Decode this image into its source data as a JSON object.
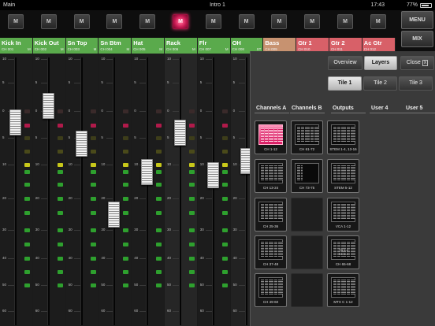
{
  "status": {
    "left": "Main",
    "center": "Intro 1",
    "time": "17:43",
    "battery": "77%"
  },
  "menu": {
    "menu_label": "MENU",
    "mix_label": "MIX"
  },
  "mute_label": "M",
  "mute_buttons": [
    {
      "on": false
    },
    {
      "on": false
    },
    {
      "on": false
    },
    {
      "on": false
    },
    {
      "on": false
    },
    {
      "on": true
    },
    {
      "on": false
    },
    {
      "on": false
    },
    {
      "on": false
    },
    {
      "on": false
    },
    {
      "on": false
    },
    {
      "on": false
    }
  ],
  "channels": [
    {
      "name": "Kick In",
      "sub": "CH 001",
      "tag": "M",
      "color": "#5aaa4c"
    },
    {
      "name": "Kick Out",
      "sub": "CH 002",
      "tag": "M",
      "color": "#5aaa4c"
    },
    {
      "name": "Sn Top",
      "sub": "CH 003",
      "tag": "M",
      "color": "#5aaa4c"
    },
    {
      "name": "Sn Btm",
      "sub": "CH 004",
      "tag": "M",
      "color": "#5aaa4c"
    },
    {
      "name": "Hat",
      "sub": "CH 005",
      "tag": "M",
      "color": "#5aaa4c"
    },
    {
      "name": "Rack",
      "sub": "CH 006",
      "tag": "M",
      "color": "#5aaa4c"
    },
    {
      "name": "Flr",
      "sub": "CH 007",
      "tag": "M",
      "color": "#5aaa4c"
    },
    {
      "name": "OH",
      "sub": "CH 008",
      "tag": "ST",
      "color": "#5aaa4c"
    },
    {
      "name": "Bass",
      "sub": "CH 009",
      "tag": "",
      "color": "#c79270"
    },
    {
      "name": "Gtr 1",
      "sub": "CH 010",
      "tag": "",
      "color": "#d86068"
    },
    {
      "name": "Gtr 2",
      "sub": "CH 011",
      "tag": "",
      "color": "#d86068"
    },
    {
      "name": "Ac Gtr",
      "sub": "CH 012",
      "tag": "",
      "color": "#d86068"
    }
  ],
  "scale": [
    "10",
    "5",
    "0",
    "5",
    "10",
    "20",
    "30",
    "40",
    "50",
    "60"
  ],
  "faders": [
    {
      "level_db": -2
    },
    {
      "level_db": 1
    },
    {
      "level_db": -6
    },
    {
      "level_db": -25
    },
    {
      "level_db": -12
    },
    {
      "level_db": -4
    },
    {
      "level_db": -13
    }
  ],
  "panel": {
    "overview_label": "Overview",
    "layers_label": "Layers",
    "close_label": "Close",
    "close_icon": "X",
    "tiles_tabs": [
      {
        "label": "Tile 1",
        "selected": true
      },
      {
        "label": "Tile 2",
        "selected": false
      },
      {
        "label": "Tile 3",
        "selected": false
      }
    ],
    "columns": [
      "Channels A",
      "Channels B",
      "Outputs",
      "User 4",
      "User 5"
    ],
    "tiles": [
      {
        "col": 0,
        "row": 0,
        "label": "CH 1-12",
        "style": "pink"
      },
      {
        "col": 1,
        "row": 0,
        "label": "CH 61-72",
        "style": "normal"
      },
      {
        "col": 2,
        "row": 0,
        "label": "STEM 1-4, 13-16",
        "style": "normal"
      },
      {
        "col": 0,
        "row": 1,
        "label": "CH 13-24",
        "style": "normal"
      },
      {
        "col": 1,
        "row": 1,
        "label": "CH 73-75",
        "style": "short"
      },
      {
        "col": 2,
        "row": 1,
        "label": "STEM 5-12",
        "style": "normal"
      },
      {
        "col": 0,
        "row": 2,
        "label": "CH 25-36",
        "style": "normal"
      },
      {
        "col": 1,
        "row": 2,
        "label": "",
        "style": "empty"
      },
      {
        "col": 2,
        "row": 2,
        "label": "VCA 1-12",
        "style": "normal"
      },
      {
        "col": 0,
        "row": 3,
        "label": "CH 37-48",
        "style": "normal"
      },
      {
        "col": 1,
        "row": 3,
        "label": "",
        "style": "empty"
      },
      {
        "col": 2,
        "row": 3,
        "label": "CH 65-68",
        "style": "overlay",
        "overlay": "TB 1-2\nS1 1-2"
      },
      {
        "col": 0,
        "row": 4,
        "label": "CH 49-60",
        "style": "normal"
      },
      {
        "col": 1,
        "row": 4,
        "label": "",
        "style": "empty"
      },
      {
        "col": 2,
        "row": 4,
        "label": "MTX C 1-12",
        "style": "normal"
      }
    ]
  }
}
